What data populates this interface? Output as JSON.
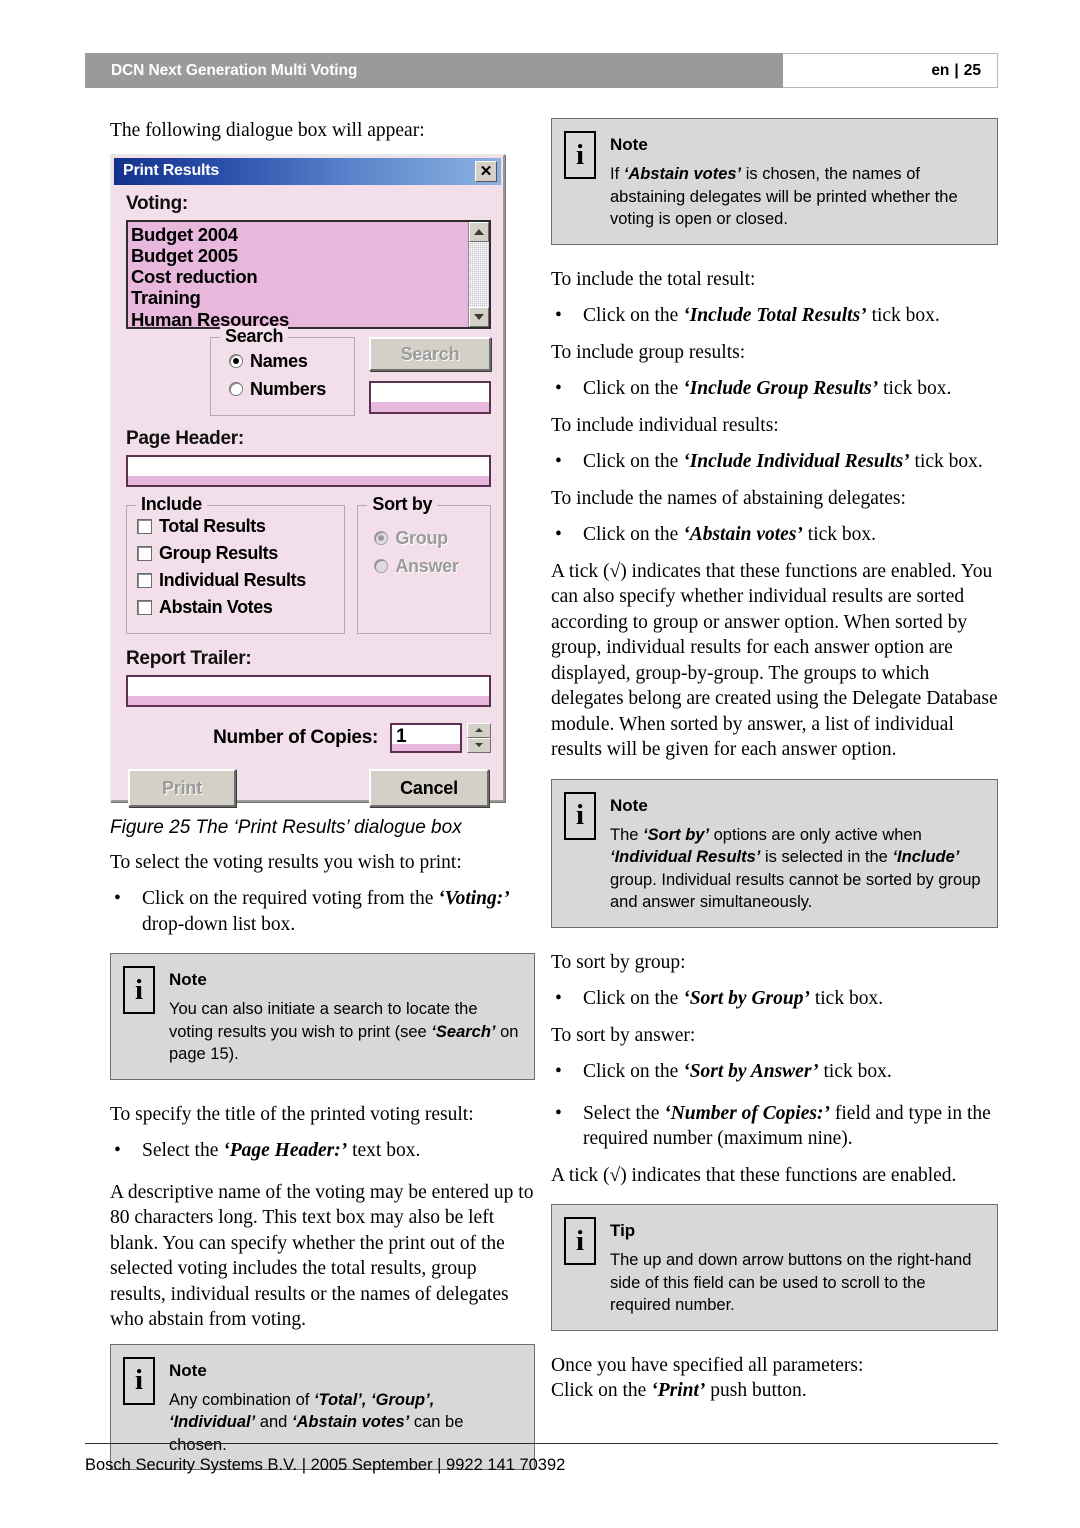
{
  "header": {
    "title": "DCN Next Generation Multi Voting",
    "lang": "en",
    "separator": "|",
    "page_number": "25"
  },
  "left_column": {
    "intro": "The following dialogue box will appear:",
    "figure_caption": "Figure 25 The ‘Print Results’ dialogue box",
    "select_intro": "To select the voting results you wish to print:",
    "bullet_select": "Click on the required voting from the ‘Voting:’ drop-down list box.",
    "note_search": {
      "icon": "i",
      "title": "Note",
      "text": "You can also initiate a search to locate the voting results you wish to print (see ‘Search’ on page 15)."
    },
    "title_intro": "To specify the title of the printed voting result:",
    "bullet_page_header": "Select the ‘Page Header:’ text box.",
    "descriptive_paragraph": "A descriptive name of the voting may be entered up to 80 characters long. This text box may also be left blank. You can specify whether the print out of the selected voting includes the total results, group results, individual results or the names of delegates who abstain from voting.",
    "note_combination": {
      "icon": "i",
      "title": "Note",
      "text": "Any combination of ‘Total’, ‘Group’, ‘Individual’ and ‘Abstain votes’ can be chosen."
    }
  },
  "dialog": {
    "title": "Print Results",
    "close_label": "✕",
    "voting_label": "Voting:",
    "voting_items": [
      "Budget 2004",
      "Budget 2005",
      "Cost reduction",
      "Training",
      "Human Resources"
    ],
    "search_group_label": "Search",
    "search_options": [
      {
        "label": "Names",
        "selected": true
      },
      {
        "label": "Numbers",
        "selected": false
      }
    ],
    "search_button_label": "Search",
    "search_field_value": "",
    "page_header_label": "Page Header:",
    "page_header_value": "",
    "include_group_label": "Include",
    "include_items": [
      {
        "label": "Total Results",
        "checked": false
      },
      {
        "label": "Group Results",
        "checked": false
      },
      {
        "label": "Individual Results",
        "checked": false
      },
      {
        "label": "Abstain Votes",
        "checked": false
      }
    ],
    "sort_by_group_label": "Sort by",
    "sort_by_options": [
      {
        "label": "Group",
        "selected": true
      },
      {
        "label": "Answer",
        "selected": false
      }
    ],
    "report_trailer_label": "Report Trailer:",
    "report_trailer_value": "",
    "copies_label": "Number of Copies:",
    "copies_value": "1",
    "print_button_label": "Print",
    "cancel_button_label": "Cancel",
    "colors": {
      "dialog_background": "#f2dfe9",
      "list_background": "#e7b8dc",
      "titlebar_start": "#13328c",
      "titlebar_end": "#8db3e2",
      "button_face": "#d4d0c8"
    }
  },
  "right_column": {
    "note_abstain": {
      "icon": "i",
      "title": "Note",
      "text_parts": {
        "before": "If ",
        "bold": "‘Abstain votes’",
        "after": " is chosen, the names of abstaining delegates will be printed whether the voting is open or closed."
      }
    },
    "total_intro": "To include the total result:",
    "bullet_total": "Click on the ‘Include Total Results’ tick box.",
    "group_intro": "To include group results:",
    "bullet_group": "Click on the ‘Include Group Results’ tick box.",
    "individual_intro": "To include individual results:",
    "bullet_individual": "Click on the ‘Include Individual Results’ tick box.",
    "abstain_intro": "To include the names of abstaining delegates:",
    "bullet_abstain": "Click on the ‘Abstain votes’ tick box.",
    "tick_paragraph": "A tick (√) indicates that these functions are enabled. You can also specify whether individual results are sorted according to group or answer option. When sorted by group, individual results for each answer option are displayed, group-by-group. The groups to which delegates belong are created using the Delegate Database module. When sorted by answer, a list of individual results will be given for each answer option.",
    "note_sortby": {
      "icon": "i",
      "title": "Note",
      "text": "The ‘Sort by’ options are only active when ‘Individual Results’ is selected in the ‘Include’ group. Individual results cannot be sorted by group and answer simultaneously."
    },
    "sort_group_intro": "To sort by group:",
    "bullet_sort_group": "Click on the ‘Sort by Group’ tick box.",
    "sort_answer_intro": "To sort by answer:",
    "bullet_sort_answer": "Click on the ‘Sort by Answer’ tick box.",
    "bullet_copies": "Select the ‘Number of Copies:’ field and type in the required number (maximum nine).",
    "tick_paragraph_2": "A tick (√) indicates that these functions are enabled.",
    "tip_arrows": {
      "icon": "i",
      "title": "Tip",
      "text": "The up and down arrow buttons on the right-hand side of this field can be used to scroll to the required number."
    },
    "closing_line_1": "Once you have specified all parameters:",
    "closing_line_2": "Click on the ‘Print’ push button."
  },
  "footer": {
    "text": "Bosch Security Systems B.V. | 2005 September | 9922 141 70392"
  }
}
